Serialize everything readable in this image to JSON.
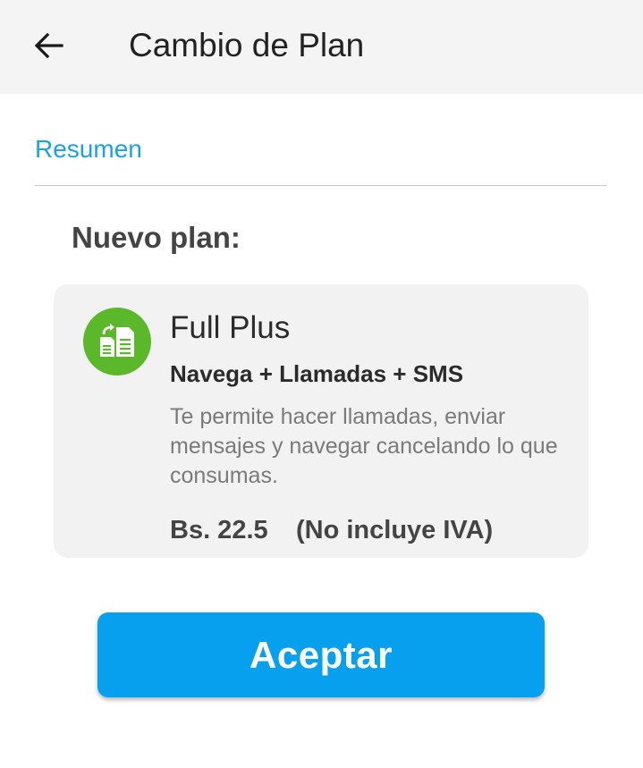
{
  "header": {
    "back_icon": "arrow-left-icon",
    "title": "Cambio de Plan"
  },
  "section": {
    "link_label": "Resumen"
  },
  "new_plan": {
    "heading": "Nuevo plan:",
    "icon": "plan-change-documents-icon",
    "icon_color": "#5cb82b",
    "name": "Full Plus",
    "features": "Navega + Llamadas + SMS",
    "description": "Te permite hacer llamadas, enviar mensajes y navegar cancelando lo que consumas.",
    "price": "Bs. 22.5",
    "tax_note": "(No incluye IVA)"
  },
  "actions": {
    "accept_label": "Aceptar",
    "accent_color": "#07a0ef"
  }
}
